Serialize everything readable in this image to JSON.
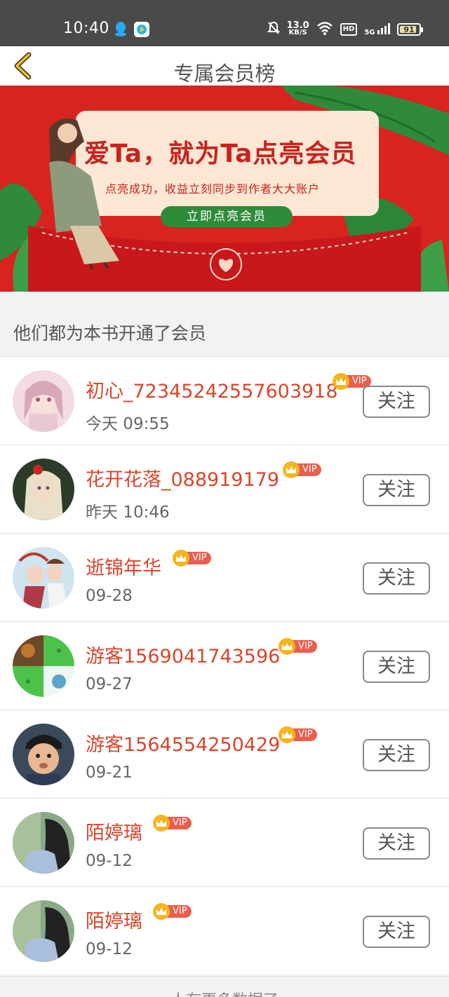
{
  "status_bar": {
    "time": "10:40",
    "net_speed_value": "13.0",
    "net_speed_unit": "KB/S",
    "hd_label": "HD",
    "signal_label": "5G",
    "battery": "91",
    "icons": [
      "qq-icon",
      "app-icon",
      "mute-icon",
      "wifi-icon",
      "signal-icon",
      "battery-icon"
    ]
  },
  "header": {
    "title": "专属会员榜",
    "back_icon": "chevron-left-icon"
  },
  "banner": {
    "headline": "爱Ta，就为Ta点亮会员",
    "subtitle": "点亮成功，收益立刻同步到作者大大账户",
    "button_label": "立即点亮会员",
    "colors": {
      "background": "#d8231f",
      "button": "#2e8b3a",
      "card": "#fbe7d4"
    }
  },
  "section": {
    "title": "他们都为本书开通了会员"
  },
  "members": [
    {
      "name": "初心_72345242557603918",
      "vip": "VIP",
      "time": "今天 09:55",
      "follow": "关注",
      "avatar_icon": "anime-girl-avatar"
    },
    {
      "name": "花开花落_088919179",
      "vip": "VIP",
      "time": "昨天 10:46",
      "follow": "关注",
      "avatar_icon": "doll-avatar"
    },
    {
      "name": "逝锦年华",
      "vip": "VIP",
      "time": "09-28",
      "follow": "关注",
      "avatar_icon": "anime-couple-avatar"
    },
    {
      "name": "游客1569041743596",
      "vip": "VIP",
      "time": "09-27",
      "follow": "关注",
      "avatar_icon": "game-avatar"
    },
    {
      "name": "游客1564554250429",
      "vip": "VIP",
      "time": "09-21",
      "follow": "关注",
      "avatar_icon": "child-avatar"
    },
    {
      "name": "陌婷璃",
      "vip": "VIP",
      "time": "09-12",
      "follow": "关注",
      "avatar_icon": "girl-photo-avatar"
    },
    {
      "name": "陌婷璃",
      "vip": "VIP",
      "time": "09-12",
      "follow": "关注",
      "avatar_icon": "girl-photo-avatar"
    }
  ],
  "footer": {
    "text": "人有更多数据了"
  },
  "colors": {
    "accent_name": "#d9462a",
    "vip_tag": "#e95f4f",
    "crown": "#f5b51f"
  }
}
